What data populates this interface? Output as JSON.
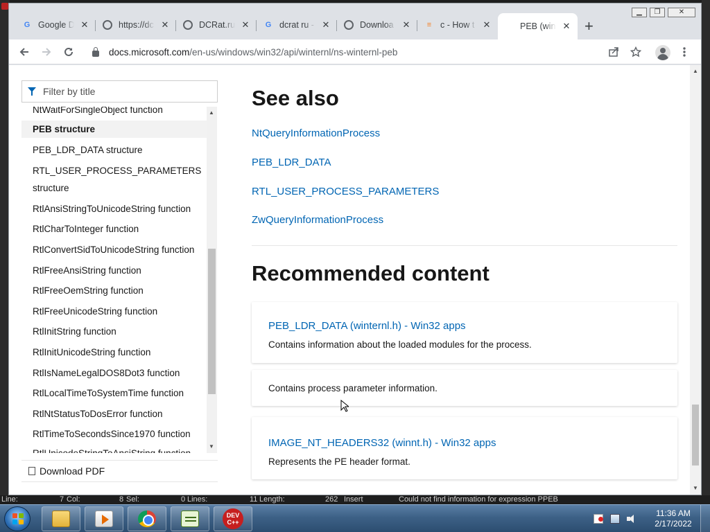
{
  "browser": {
    "tabs": [
      {
        "title": "Google D",
        "favicon": "google-icon"
      },
      {
        "title": "https://dc",
        "favicon": "globe-icon"
      },
      {
        "title": "DCRat.ru",
        "favicon": "globe-icon"
      },
      {
        "title": "dcrat ru -",
        "favicon": "google-icon"
      },
      {
        "title": "Downloa",
        "favicon": "globe-icon"
      },
      {
        "title": "c - How t",
        "favicon": "stackoverflow-icon"
      },
      {
        "title": "PEB (win",
        "favicon": "microsoft-icon",
        "active": true
      }
    ],
    "close_glyph": "✕",
    "newtab_glyph": "+",
    "address": {
      "domain": "docs.microsoft.com",
      "path": "/en-us/windows/win32/api/winternl/ns-winternl-peb"
    }
  },
  "sidebar": {
    "filter_placeholder": "Filter by title",
    "items": [
      {
        "label": "NtWaitForSingleObject function"
      },
      {
        "label": "PEB structure",
        "active": true
      },
      {
        "label": "PEB_LDR_DATA structure"
      },
      {
        "label": "RTL_USER_PROCESS_PARAMETERS"
      },
      {
        "label": "structure"
      },
      {
        "label": "RtlAnsiStringToUnicodeString function"
      },
      {
        "label": "RtlCharToInteger function"
      },
      {
        "label": "RtlConvertSidToUnicodeString function"
      },
      {
        "label": "RtlFreeAnsiString function"
      },
      {
        "label": "RtlFreeOemString function"
      },
      {
        "label": "RtlFreeUnicodeString function"
      },
      {
        "label": "RtlInitString function"
      },
      {
        "label": "RtlInitUnicodeString function"
      },
      {
        "label": "RtlIsNameLegalDOS8Dot3 function"
      },
      {
        "label": "RtlLocalTimeToSystemTime function"
      },
      {
        "label": "RtlNtStatusToDosError function"
      },
      {
        "label": "RtlTimeToSecondsSince1970 function"
      },
      {
        "label": "RtlUnicodeStringToAnsiString function"
      }
    ],
    "download_pdf": "Download PDF"
  },
  "main": {
    "see_also_heading": "See also",
    "see_also_links": [
      "NtQueryInformationProcess",
      "PEB_LDR_DATA",
      "RTL_USER_PROCESS_PARAMETERS",
      "ZwQueryInformationProcess"
    ],
    "recommended_heading": "Recommended content",
    "cards": [
      {
        "title": "PEB_LDR_DATA (winternl.h) - Win32 apps",
        "desc": "Contains information about the loaded modules for the process."
      },
      {
        "title": "",
        "desc": "Contains process parameter information."
      },
      {
        "title": "IMAGE_NT_HEADERS32 (winnt.h) - Win32 apps",
        "desc": "Represents the PE header format."
      }
    ]
  },
  "ide_status": {
    "line": "Line:",
    "line_val": "7",
    "col": "Col:",
    "col_val": "8",
    "sel": "Sel:",
    "sel_val": "0",
    "lines": "Lines:",
    "lines_val": "11",
    "length": "Length:",
    "length_val": "262",
    "mode": "Insert",
    "message": "Could not find information for expression  PPEB"
  },
  "taskbar": {
    "apps": [
      "folder-icon",
      "media-player-icon",
      "chrome-icon",
      "notepad-icon",
      "devcpp-icon"
    ],
    "devcpp_label_1": "DEV",
    "devcpp_label_2": "C++",
    "time": "11:36 AM",
    "date": "2/17/2022"
  },
  "colors": {
    "link": "#0065b3",
    "text": "#171717",
    "chrome_frame": "#dee1e6"
  }
}
